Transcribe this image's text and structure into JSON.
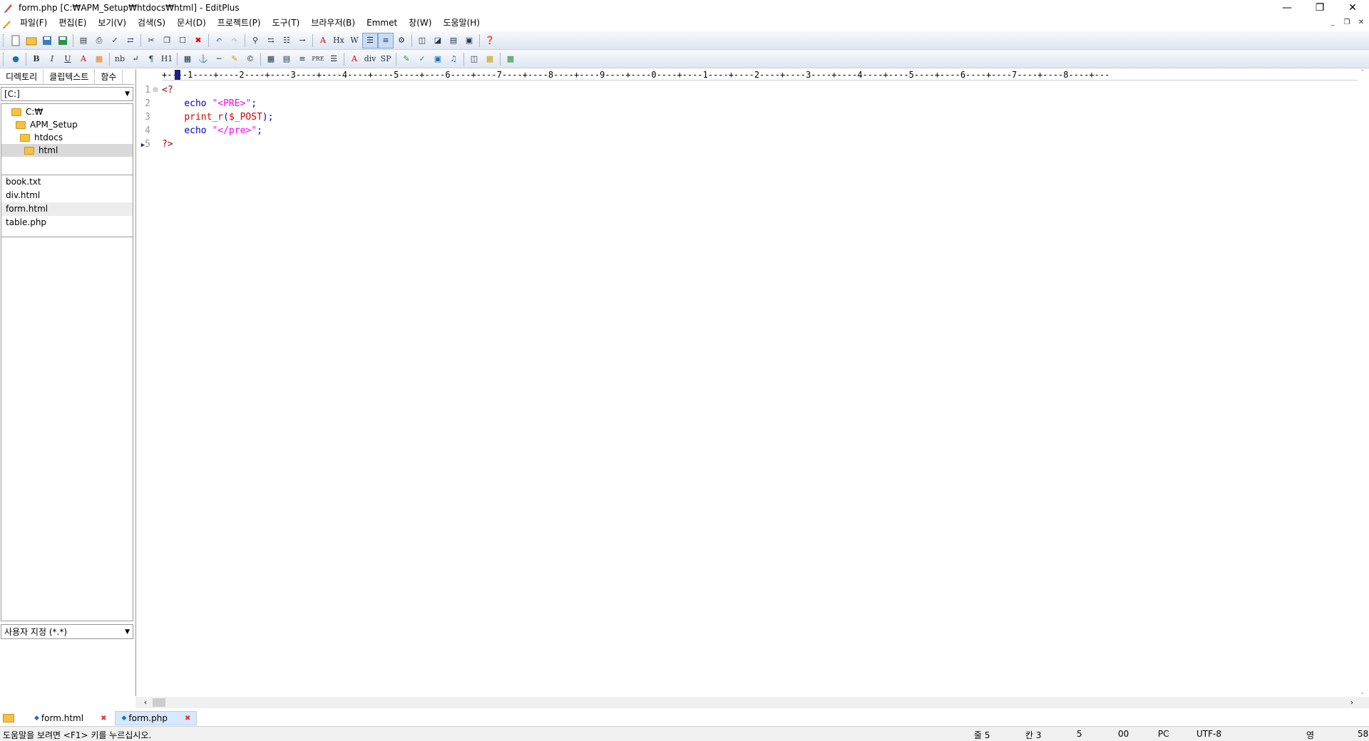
{
  "window": {
    "title": "form.php [C:₩APM_Setup₩htdocs₩html] - EditPlus"
  },
  "menu": [
    "파일(F)",
    "편집(E)",
    "보기(V)",
    "검색(S)",
    "문서(D)",
    "프로젝트(P)",
    "도구(T)",
    "브라우저(B)",
    "Emmet",
    "창(W)",
    "도움말(H)"
  ],
  "toolbar2_text": {
    "nb": "nb",
    "pre": "PRE",
    "div": "div",
    "sp": "SP",
    "hx": "Hx",
    "ht": "H1"
  },
  "left": {
    "tabs": [
      "디렉토리",
      "클립텍스트",
      "함수"
    ],
    "drive": "[C:]",
    "tree": [
      "C:₩",
      "APM_Setup",
      "htdocs",
      "html"
    ],
    "files": [
      "book.txt",
      "div.html",
      "form.html",
      "table.php"
    ],
    "filter": "사용자 지정 (*.*)"
  },
  "editor": {
    "ruler": "+----1----+----2----+----3----+----4----+----5----+----6----+----7----+----8----+----9----+----0----+----1----+----2----+----3----+----4----+----5----+----6----+----7----+----8----+---",
    "line_numbers": [
      "1",
      "2",
      "3",
      "4",
      "5"
    ],
    "code": {
      "l1": "<?",
      "l2_kw": "echo",
      "l2_str": "\"<PRE>\"",
      "l2_end": ";",
      "l3_fn": "print_r",
      "l3_paren": "(",
      "l3_var": "$_POST",
      "l3_end": ");",
      "l4_kw": "echo",
      "l4_str": "\"</pre>\"",
      "l4_end": ";",
      "l5": "?>"
    }
  },
  "doc_tabs": [
    {
      "label": "form.html"
    },
    {
      "label": "form.php"
    }
  ],
  "status": {
    "help": "도움말을 보려면 <F1> 키를 누르십시오.",
    "line": "줄 5",
    "col": "칸 3",
    "count": "5",
    "code": "00",
    "eol": "PC",
    "encoding": "UTF-8",
    "ime": "영",
    "num": "58"
  },
  "colors": {
    "keyword": "#0000c0",
    "string": "#ff00ff",
    "function": "#d10000",
    "php_tag": "#990000"
  }
}
